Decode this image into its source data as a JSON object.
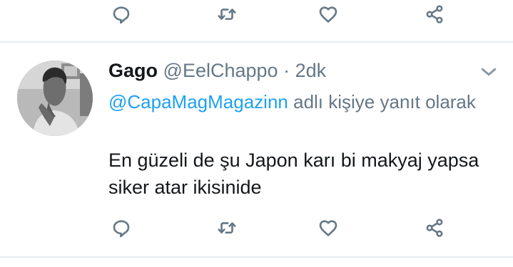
{
  "prev_tweet": {
    "actions": {
      "reply_icon": "reply-icon",
      "retweet_icon": "retweet-icon",
      "like_icon": "heart-icon",
      "share_icon": "share-icon"
    }
  },
  "tweet": {
    "display_name": "Gago",
    "handle": "@EelChappo",
    "separator": "·",
    "timestamp": "2dk",
    "reply_mention": "@CapaMagMagazinn",
    "reply_suffix": "adlı kişiye yanıt olarak",
    "text": "En güzeli de şu Japon karı bi makyaj yapsa siker atar ikisinide",
    "actions": {
      "reply_icon": "reply-icon",
      "retweet_icon": "retweet-icon",
      "like_icon": "heart-icon",
      "share_icon": "share-icon"
    }
  },
  "colors": {
    "link": "#1da1f2",
    "secondary_text": "#657786",
    "primary_text": "#14171a",
    "divider": "#e6ecf0"
  }
}
